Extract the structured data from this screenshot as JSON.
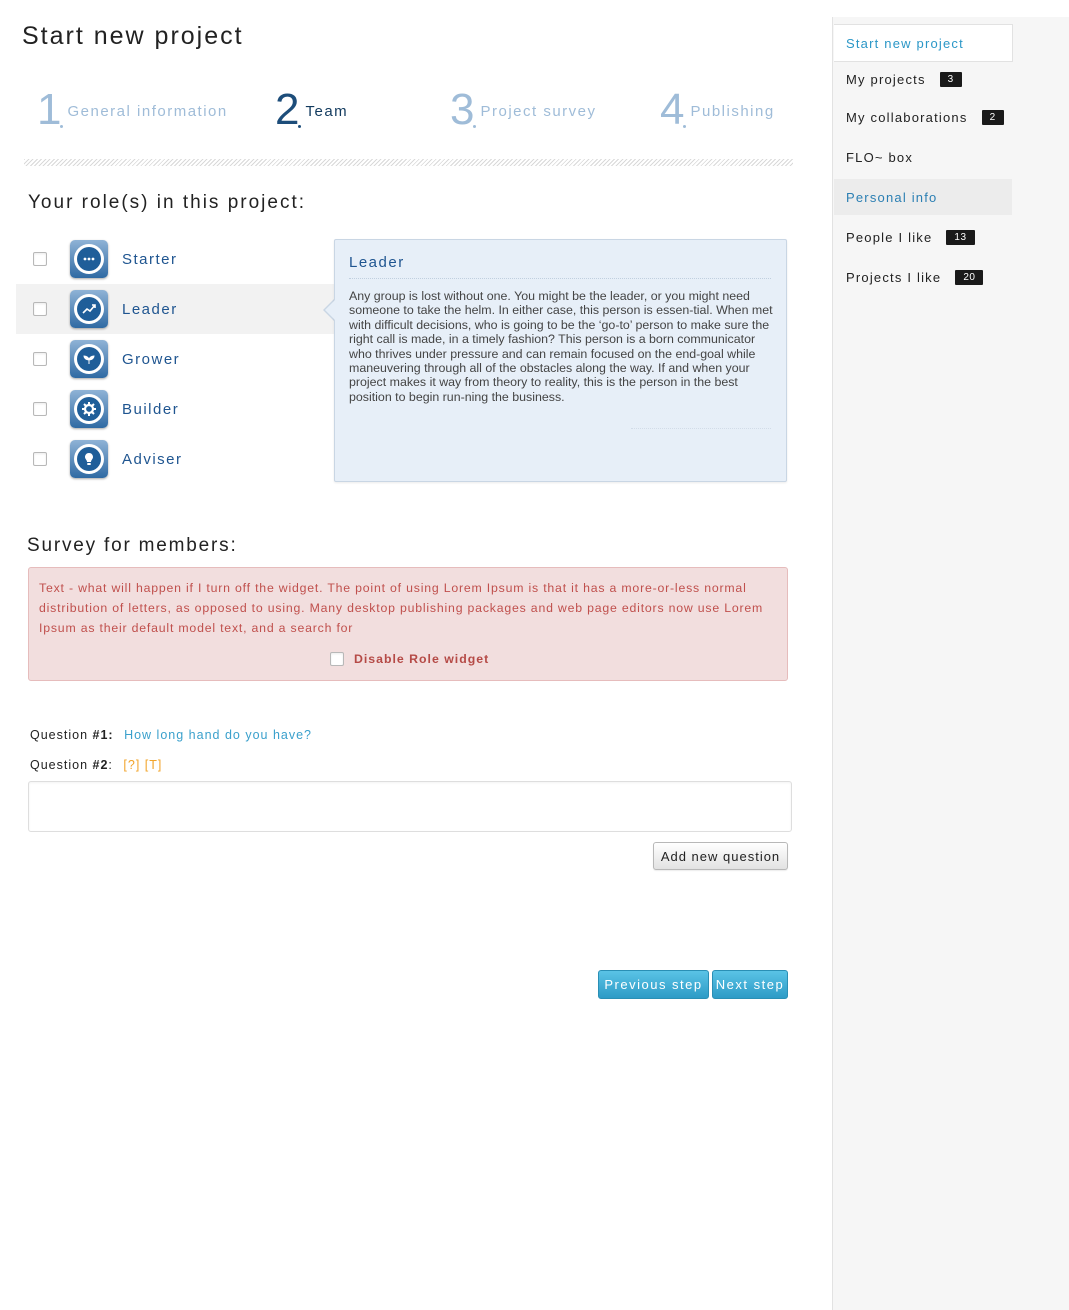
{
  "page_title": "Start new project",
  "steps": [
    {
      "number": "1",
      "label": "General information",
      "active": false
    },
    {
      "number": "2",
      "label": "Team",
      "active": true
    },
    {
      "number": "3",
      "label": "Project survey",
      "active": false
    },
    {
      "number": "4",
      "label": "Publishing",
      "active": false
    }
  ],
  "roles_section": {
    "title": "Your role(s) in this project:",
    "roles": [
      {
        "label": "Starter",
        "icon": "chat-bubble-icon",
        "checked": false
      },
      {
        "label": "Leader",
        "icon": "trend-chart-icon",
        "checked": false,
        "selected": true
      },
      {
        "label": "Grower",
        "icon": "sprout-icon",
        "checked": false
      },
      {
        "label": "Builder",
        "icon": "gear-icon",
        "checked": false
      },
      {
        "label": "Adviser",
        "icon": "lightbulb-icon",
        "checked": false
      }
    ],
    "description": {
      "title": "Leader",
      "text": "Any group is lost without one. You might be the leader, or you might need someone to take the helm. In either case, this person is essen-tial. When met with difficult decisions, who is going to be the ‘go-to’ person to make sure the right call is made, in a timely fashion? This person is a born communicator who thrives under pressure and can remain focused on the end-goal while maneuvering through all of the obstacles along the way. If and when your project makes it way from theory to reality, this is the person in the best position to begin run-ning the business."
    }
  },
  "survey": {
    "title": "Survey for members:",
    "alert_text": "Text - what will happen if I turn off the widget. The point of using Lorem Ipsum is that it has a more-or-less normal distribution of letters, as opposed to using. Many desktop publishing packages and web page editors now use Lorem Ipsum as their default model text, and a search for",
    "disable_label": "Disable Role widget",
    "questions": [
      {
        "prefix": "Question ",
        "number": "#1",
        "suffix": ":",
        "text": "How long hand do you have?"
      },
      {
        "prefix": "Question ",
        "number": "#2",
        "suffix": ":",
        "tools": "[?] [T]"
      }
    ],
    "new_question_value": "",
    "add_question_label": "Add new question"
  },
  "nav": {
    "previous_label": "Previous step",
    "next_label": "Next step"
  },
  "sidebar": {
    "items": [
      {
        "label": "Start new project",
        "badge": null
      },
      {
        "label": "My projects",
        "badge": "3"
      },
      {
        "label": "My collaborations",
        "badge": "2"
      },
      {
        "label": "FLO~ box",
        "badge": null
      },
      {
        "label": "Personal info",
        "badge": null
      },
      {
        "label": "People I like",
        "badge": "13"
      },
      {
        "label": "Projects I like",
        "badge": "20"
      }
    ]
  },
  "colors": {
    "accent_blue": "#1f5590",
    "link_blue": "#3aa0cc",
    "alert_bg": "#f2dede",
    "alert_text": "#c0504d",
    "button_blue": "#2d9bc6"
  }
}
